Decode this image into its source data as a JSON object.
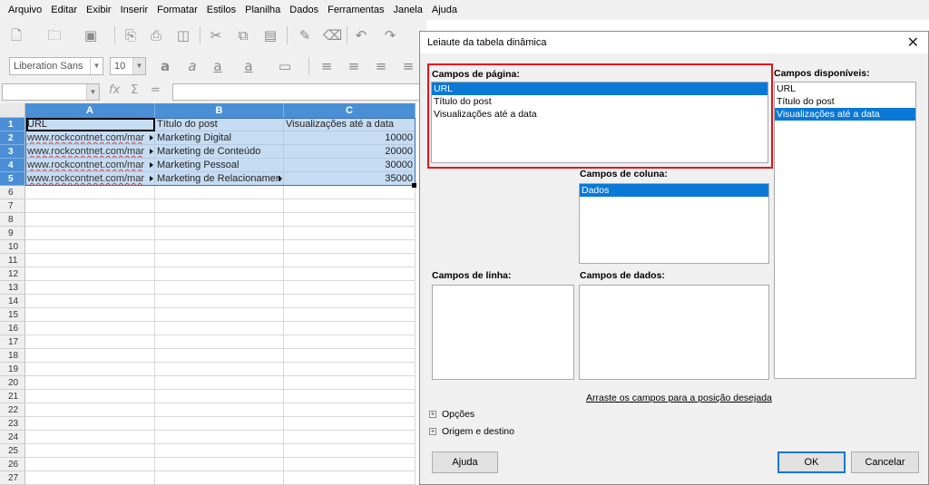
{
  "menu": [
    "Arquivo",
    "Editar",
    "Exibir",
    "Inserir",
    "Formatar",
    "Estilos",
    "Planilha",
    "Dados",
    "Ferramentas",
    "Janela",
    "Ajuda"
  ],
  "toolbar": {
    "font_name": "Liberation Sans",
    "font_size": "10",
    "fx_icon": "fx-icon",
    "sum_icon": "Σ",
    "equals_icon": "="
  },
  "sheet": {
    "columns": [
      "A",
      "B",
      "C"
    ],
    "rows": [
      "1",
      "2",
      "3",
      "4",
      "5",
      "6",
      "7",
      "8",
      "9",
      "10",
      "11",
      "12",
      "13",
      "14",
      "15",
      "16",
      "17",
      "18",
      "19",
      "20",
      "21",
      "22",
      "23",
      "24",
      "25",
      "26",
      "27"
    ],
    "data": [
      [
        "URL",
        "Título do post",
        "Visualizações até a data"
      ],
      [
        "www.rockcontnet.com/mar",
        "Marketing Digital",
        "10000"
      ],
      [
        "www.rockcontnet.com/mar",
        "Marketing de Conteúdo",
        "20000"
      ],
      [
        "www.rockcontnet.com/mar",
        "Marketing Pessoal",
        "30000"
      ],
      [
        "www.rockcontnet.com/mar",
        "Marketing de Relacionamen",
        "35000"
      ]
    ]
  },
  "dialog": {
    "title": "Leiaute da tabela dinâmica",
    "page_fields_label": "Campos de página:",
    "page_fields": [
      "URL",
      "Título do post",
      "Visualizações até a data"
    ],
    "page_fields_selected": 0,
    "available_label": "Campos disponíveis:",
    "available_fields": [
      "URL",
      "Título do post",
      "Visualizações até a data"
    ],
    "available_selected": 2,
    "column_label": "Campos de coluna:",
    "column_fields": [
      "Dados"
    ],
    "row_label": "Campos de linha:",
    "data_label": "Campos de dados:",
    "hint": "Arraste os campos para a posição desejada",
    "options_label": "Opções",
    "source_label": "Origem e destino",
    "help_button": "Ajuda",
    "ok_button": "OK",
    "cancel_button": "Cancelar",
    "close_icon": "close-icon"
  },
  "colors": {
    "selection_blue": "#0a78d7",
    "header_blue": "#4a8fd6",
    "highlight_red": "#e8101a",
    "selected_cell": "#c6dcf2"
  }
}
